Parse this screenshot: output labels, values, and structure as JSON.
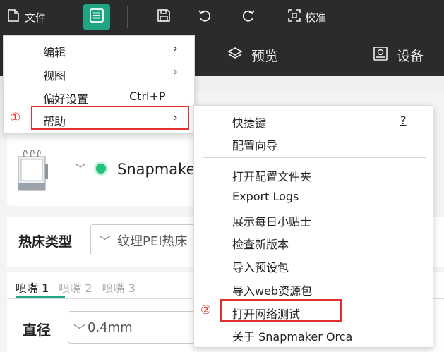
{
  "toolbar": {
    "file_label": "文件",
    "calibrate_label": "校准"
  },
  "nav": {
    "preview_label": "预览",
    "device_label": "设备"
  },
  "printer": {
    "name": "Snapmake"
  },
  "bed": {
    "label": "热床类型",
    "value": "纹理PEI热床"
  },
  "nozzle": {
    "tabs": [
      "喷嘴 1",
      "喷嘴 2",
      "喷嘴 3"
    ],
    "diameter_label": "直径",
    "diameter_value": "0.4mm"
  },
  "main_menu": {
    "items": [
      {
        "label": "编辑",
        "arrow": "›"
      },
      {
        "label": "视图",
        "arrow": "›"
      },
      {
        "label": "偏好设置",
        "shortcut": "Ctrl+P"
      },
      {
        "label": "帮助",
        "arrow": "›"
      }
    ]
  },
  "help_menu": {
    "items": [
      {
        "label": "快捷键",
        "shortcut": "?"
      },
      {
        "label": "配置向导"
      },
      {
        "label": "打开配置文件夹"
      },
      {
        "label": "Export Logs"
      },
      {
        "label": "展示每日小贴士"
      },
      {
        "label": "检查新版本"
      },
      {
        "label": "导入预设包"
      },
      {
        "label": "导入web资源包"
      },
      {
        "label": "打开网络测试"
      },
      {
        "label": "关于 Snapmaker Orca"
      }
    ]
  },
  "annotations": {
    "step1": "①",
    "step2": "②"
  },
  "colors": {
    "accent": "#1fa582",
    "highlight": "#e03030",
    "toolbar_bg": "#2b2b2e"
  }
}
